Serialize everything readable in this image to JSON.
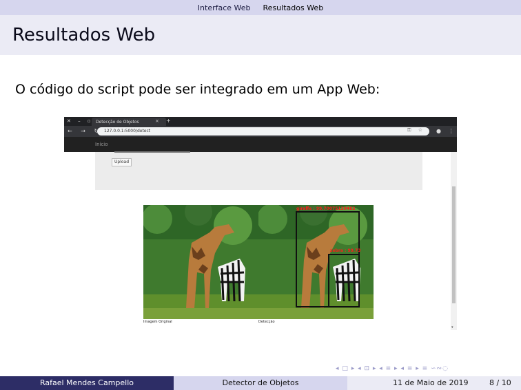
{
  "topnav": {
    "items": [
      "Interface Web",
      "Resultados Web"
    ],
    "active_index": 1
  },
  "frame": {
    "title": "Resultados Web",
    "intro": "O código do script pode ser integrado em um App Web:"
  },
  "screenshot": {
    "tab_title": "Detecção de Objetos",
    "url": "127.0.0.1:5000/detect",
    "app_nav_label": "Início",
    "upload_button": "Upload",
    "caption_left": "Imagem Original",
    "caption_right": "Detecção",
    "detections": [
      {
        "label": "giraffe : 99.70075130462",
        "color": "#ff1a1a"
      },
      {
        "label": "zebra : 99.73",
        "color": "#ff1a1a"
      }
    ]
  },
  "beamer_nav": "◂ □ ▸ ◂ ⊡ ▸ ◂ ≡ ▸ ◂ ≡ ▸ ≡ ∽∾◌",
  "footer": {
    "author": "Rafael Mendes Campello",
    "title": "Detector de Objetos",
    "date": "11 de Maio de 2019",
    "pages": "8 / 10"
  }
}
